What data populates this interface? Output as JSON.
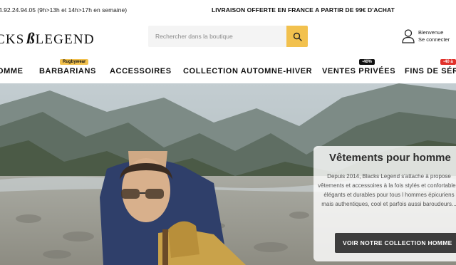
{
  "topbar": {
    "phone": "4.92.24.94.05 (9h>13h et 14h>17h en semaine)",
    "promo": "LIVRAISON OFFERTE EN FRANCE A PARTIR DE 99€ D'ACHAT"
  },
  "header": {
    "logo_left": "CKS",
    "logo_right": "LEGEND",
    "search_placeholder": "Rechercher dans la boutique",
    "account_greeting": "Bienvenue",
    "account_login": "Se connecter"
  },
  "nav": {
    "items": [
      {
        "label": "OMME"
      },
      {
        "label": "BARBARIANS",
        "badge": "Rugbywear"
      },
      {
        "label": "ACCESSOIRES"
      },
      {
        "label": "COLLECTION AUTOMNE-HIVER"
      },
      {
        "label": "VENTES PRIVÉES",
        "badge": "-40%"
      },
      {
        "label": "FINS DE SÉRI",
        "badge": "-40 à"
      }
    ]
  },
  "hero": {
    "title": "Vêtements pour homme",
    "description": "Depuis 2014, Blacks Legend s'attache à propose vêtements et accessoires à la fois stylés et confortables, élégants et durables pour tous l hommes épicuriens mais authentiques, cool et parfois aussi baroudeurs...",
    "cta": "VOIR NOTRE COLLECTION HOMME"
  },
  "colors": {
    "accent_yellow": "#f2c14e",
    "badge_red": "#e0312b",
    "cta_dark": "#3d3d3d"
  }
}
